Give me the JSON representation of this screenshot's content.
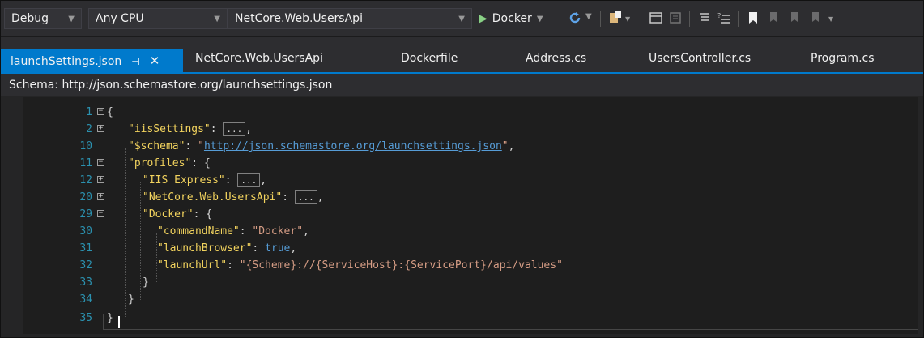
{
  "toolbar": {
    "config": "Debug",
    "platform": "Any CPU",
    "startup_project": "NetCore.Web.UsersApi",
    "run_target": "Docker"
  },
  "tabs": [
    {
      "label": "launchSettings.json"
    },
    {
      "label": "NetCore.Web.UsersApi"
    },
    {
      "label": "Dockerfile"
    },
    {
      "label": "Address.cs"
    },
    {
      "label": "UsersController.cs"
    },
    {
      "label": "Program.cs"
    }
  ],
  "schema": {
    "prefix": "Schema:",
    "url": "http://json.schemastore.org/launchsettings.json"
  },
  "editor": {
    "lines": [
      {
        "n": "1"
      },
      {
        "n": "2"
      },
      {
        "n": "10"
      },
      {
        "n": "11"
      },
      {
        "n": "12"
      },
      {
        "n": "20"
      },
      {
        "n": "29"
      },
      {
        "n": "30"
      },
      {
        "n": "31"
      },
      {
        "n": "32"
      },
      {
        "n": "33"
      },
      {
        "n": "34"
      },
      {
        "n": "35"
      }
    ],
    "collapsed_marker": "...",
    "tokens": {
      "open_brace": "{",
      "close_brace": "}",
      "iis_settings_key": "\"iisSettings\"",
      "schema_key": "\"$schema\"",
      "schema_value": "http://json.schemastore.org/launchsettings.json",
      "profiles_key": "\"profiles\"",
      "iis_express_key": "\"IIS Express\"",
      "users_api_key": "\"NetCore.Web.UsersApi\"",
      "docker_key": "\"Docker\"",
      "command_name_key": "\"commandName\"",
      "command_name_value": "\"Docker\"",
      "launch_browser_key": "\"launchBrowser\"",
      "launch_browser_value": "true",
      "launch_url_key": "\"launchUrl\"",
      "launch_url_value": "\"{Scheme}://{ServiceHost}:{ServicePort}/api/values\""
    }
  }
}
